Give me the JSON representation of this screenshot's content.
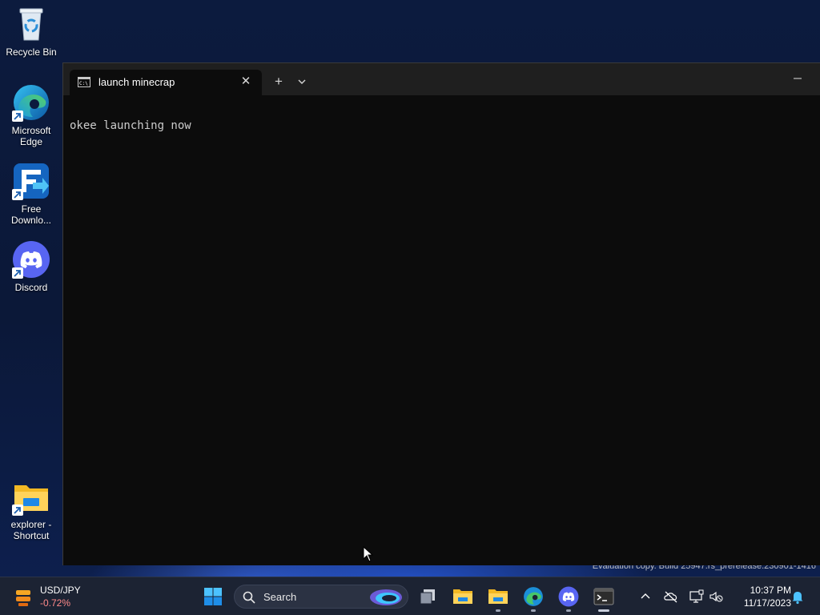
{
  "desktop": {
    "icons": [
      {
        "label": "Recycle Bin",
        "icon": "recycle-bin-icon"
      },
      {
        "label": "Microsoft Edge",
        "icon": "edge-icon"
      },
      {
        "label": "Free Downlo...",
        "icon": "free-download-manager-icon"
      },
      {
        "label": "Discord",
        "icon": "discord-icon"
      },
      {
        "label": "explorer - Shortcut",
        "icon": "folder-icon"
      }
    ],
    "watermark": "Evaluation copy. Build 25947.rs_prerelease.230901-1416"
  },
  "terminal": {
    "tab_title": "launch minecrap",
    "tab_close": "✕",
    "new_tab": "+",
    "output": "okee launching now"
  },
  "taskbar": {
    "widget": {
      "title": "USD/JPY",
      "change": "-0.72%"
    },
    "search_label": "Search",
    "apps": [
      "start",
      "task-view",
      "file-explorer",
      "file-explorer-2",
      "edge",
      "discord",
      "terminal"
    ],
    "clock": {
      "time": "10:37 PM",
      "date": "11/17/2023"
    }
  },
  "colors": {
    "terminal_bg": "#0c0c0c",
    "titlebar_bg": "#1f1f1f",
    "taskbar_bg": "#1c2333",
    "accent": "#0078d4",
    "discord": "#5865f2"
  }
}
